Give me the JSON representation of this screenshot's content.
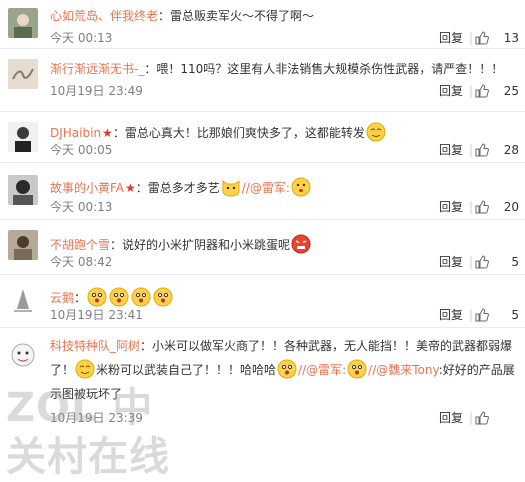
{
  "reply_label": "回复",
  "like_icon": "thumb-up-icon",
  "emoji_icon": "smiley-emoji-icon",
  "watermark": "ZOL 中关村在线",
  "comments": [
    {
      "user": "心如荒岛、伴我终老",
      "text": "：雷总贩卖军火～不得了啊～",
      "time": "今天 00:13",
      "likes": "13"
    },
    {
      "user": "渐行渐远渐无书-_",
      "text": "：喂！110吗？这里有人非法销售大规模杀伤性武器，请严查！！！",
      "time": "10月19日 23:49",
      "likes": "25"
    },
    {
      "user": "DJHaibin",
      "vip": "★",
      "text": "：雷总心真大！比那娘们爽快多了，这都能转发",
      "time": "今天 00:05",
      "likes": "28"
    },
    {
      "user": "故事的小黄FA",
      "vip": "★",
      "text": "：雷总多才多艺",
      "text2": "//@雷军:",
      "time": "今天 00:13",
      "likes": "20"
    },
    {
      "user": "不胡跑个雪",
      "text": "：说好的小米扩阴器和小米跳蛋呢",
      "time": "今天 08:42",
      "likes": "5"
    },
    {
      "user": "云鹅",
      "text": "：",
      "time": "10月19日 23:41",
      "likes": "5"
    },
    {
      "user": "科技特种队_阿树",
      "text": "：小米可以做军火商了！！各种武器，无人能挡！！美帝的武器都弱爆了！",
      "text_b": "米粉可以武装自己了！！！哈哈哈",
      "mention1": "//@雷军:",
      "mention2": "//@魏来Tony",
      "text_c": ":好好的产品展示图被玩坏了",
      "time": "10月19日 23:39",
      "likes": ""
    }
  ]
}
